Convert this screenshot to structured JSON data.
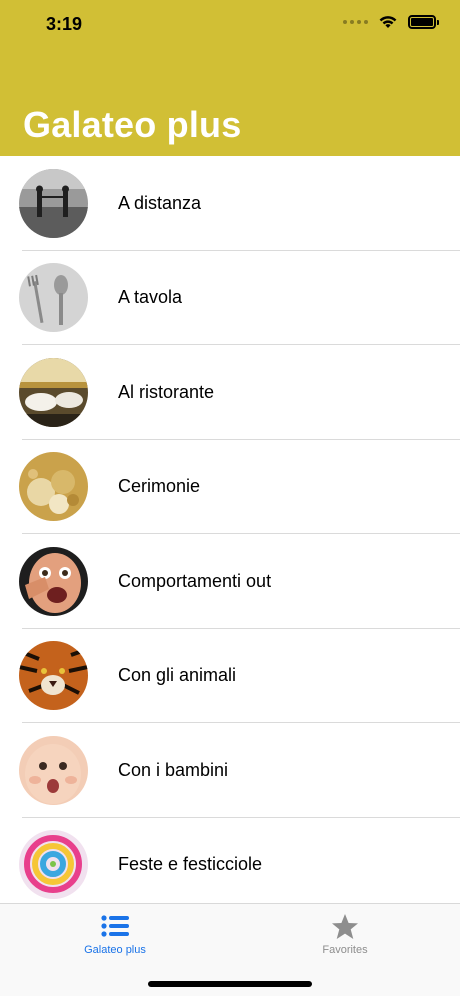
{
  "status_bar": {
    "time": "3:19"
  },
  "header": {
    "title": "Galateo plus",
    "color": "#d1bf35"
  },
  "list": {
    "items": [
      {
        "label": "A distanza",
        "icon": "couple-photo"
      },
      {
        "label": "A tavola",
        "icon": "cutlery-photo"
      },
      {
        "label": "Al ristorante",
        "icon": "restaurant-photo"
      },
      {
        "label": "Cerimonie",
        "icon": "ceremony-photo"
      },
      {
        "label": "Comportamenti out",
        "icon": "shocked-face-photo"
      },
      {
        "label": "Con gli animali",
        "icon": "tiger-photo"
      },
      {
        "label": "Con i bambini",
        "icon": "baby-photo"
      },
      {
        "label": "Feste e festicciole",
        "icon": "candy-photo"
      }
    ]
  },
  "tabbar": {
    "tabs": [
      {
        "label": "Galateo plus",
        "icon": "list-icon",
        "active": true
      },
      {
        "label": "Favorites",
        "icon": "star-icon",
        "active": false
      }
    ],
    "active_color": "#1a73e8",
    "inactive_color": "#8e8e8e"
  }
}
